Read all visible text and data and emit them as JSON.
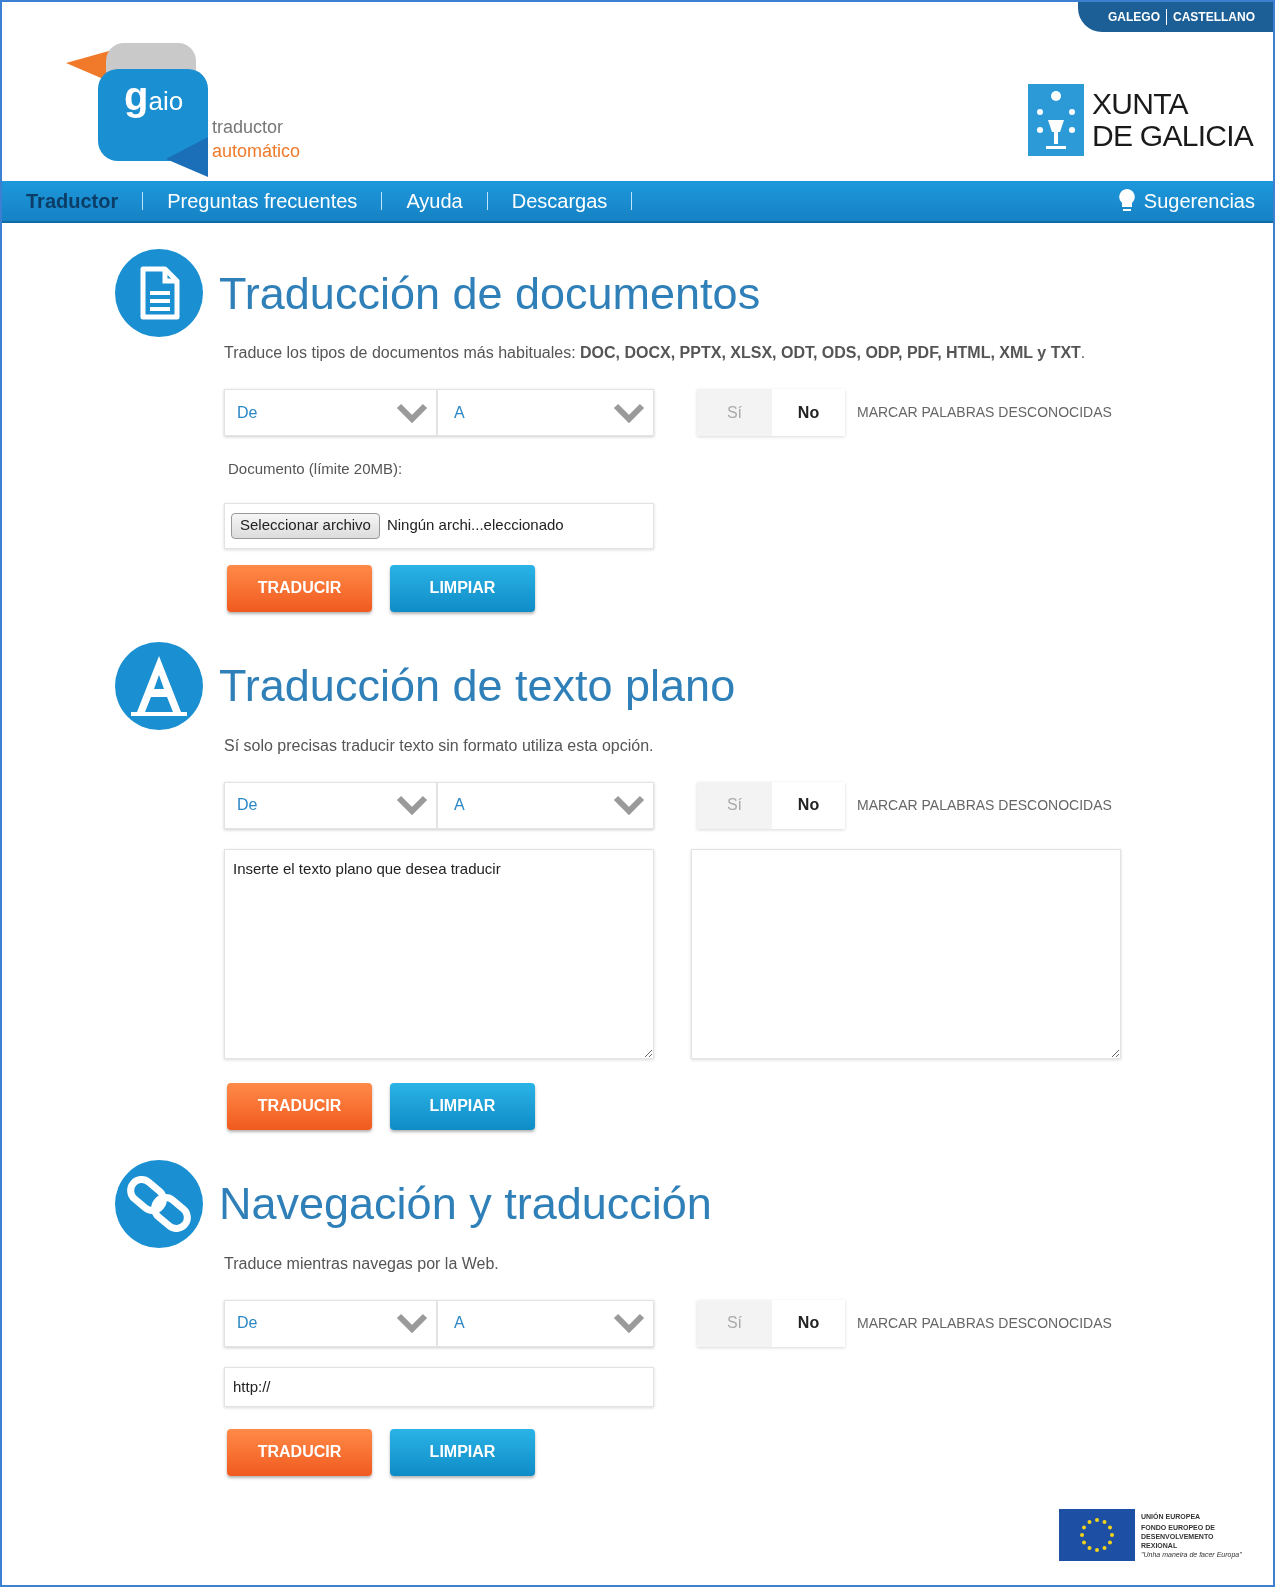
{
  "header": {
    "languages": [
      "GALEGO",
      "CASTELLANO"
    ],
    "logo": {
      "initial": "g",
      "rest": "aio",
      "line1": "traductor",
      "line2": "automático"
    },
    "government": {
      "line1": "XUNTA",
      "line2": "DE GALICIA"
    }
  },
  "nav": {
    "items": [
      {
        "label": "Traductor",
        "selected": true
      },
      {
        "label": "Preguntas frecuentes",
        "selected": false
      },
      {
        "label": "Ayuda",
        "selected": false
      },
      {
        "label": "Descargas",
        "selected": false
      }
    ],
    "suggestions": "Sugerencias"
  },
  "sections": [
    {
      "kind": "document",
      "title": "Traducción de documentos",
      "description": "Traduce los tipos de documentos más habituales: **DOC, DOCX, PPTX, XLSX, ODT, ODS, ODP, PDF, HTML, XML y TXT**.",
      "from": "De",
      "to": "A",
      "toggle": [
        {
          "label": "Sí",
          "selected": false
        },
        {
          "label": "No",
          "selected": true
        }
      ],
      "toggle_label": "MARCAR PALABRAS DESCONOCIDAS",
      "file_label": "Documento (límite 20MB):",
      "file_button": "Seleccionar archivo",
      "file_status": "Ningún archi...eleccionado",
      "buttons": [
        "TRADUCIR",
        "LIMPIAR"
      ]
    },
    {
      "kind": "text",
      "title": "Traducción de texto plano",
      "description": "Sí solo precisas traducir texto sin formato utiliza esta opción.",
      "from": "De",
      "to": "A",
      "toggle": [
        {
          "label": "Sí",
          "selected": false
        },
        {
          "label": "No",
          "selected": true
        }
      ],
      "toggle_label": "MARCAR PALABRAS DESCONOCIDAS",
      "placeholder": "Inserte el texto plano que desea traducir",
      "buttons": [
        "TRADUCIR",
        "LIMPIAR"
      ]
    },
    {
      "kind": "url",
      "title": "Navegación y traducción",
      "description": "Traduce mientras navegas por la Web.",
      "from": "De",
      "to": "A",
      "toggle": [
        {
          "label": "Sí",
          "selected": false
        },
        {
          "label": "No",
          "selected": true
        }
      ],
      "toggle_label": "MARCAR PALABRAS DESCONOCIDAS",
      "url": "http://",
      "buttons": [
        "TRADUCIR",
        "LIMPIAR"
      ]
    }
  ],
  "footer": {
    "eu_lines": [
      "UNIÓN EUROPEA",
      "FONDO EUROPEO DE DESENVOLVEMENTO REXIONAL"
    ],
    "eu_motto": "\"Unha maneira de facer Europa\""
  }
}
